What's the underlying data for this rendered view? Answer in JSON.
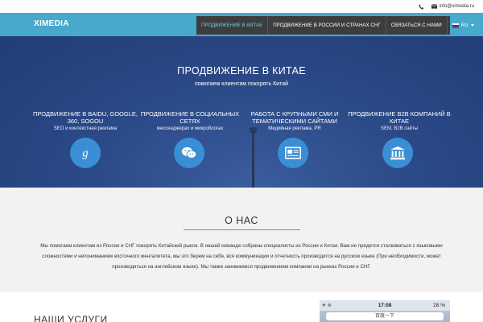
{
  "topbar": {
    "phone_icon": "phone-icon",
    "mail_icon": "envelope-icon",
    "email": "info@ximedia.ru"
  },
  "navbar": {
    "logo": "XIMEDIA",
    "items": [
      {
        "label": "ПРОДВИЖЕНИЕ В КИТАЕ",
        "active": true
      },
      {
        "label": "ПРОДВИЖЕНИЕ В РОССИИ И СТРАНАХ СНГ",
        "active": false
      },
      {
        "label": "СВЯЗАТЬСЯ С НАМИ",
        "active": false
      }
    ],
    "language": "RU",
    "colors": {
      "bar": "#47a9cc",
      "menu": "#3d3d3d",
      "active": "#79c8e6"
    }
  },
  "hero": {
    "title": "ПРОДВИЖЕНИЕ В КИТАЕ",
    "subtitle": "помогаем клиентам покорять Китай",
    "features": [
      {
        "title": "ПРОДВИЖЕНИЕ В BAIDU, GOOGLE, 360, SOGOU",
        "desc": "SEO и контекстная реклама",
        "icon": "google-plus-icon"
      },
      {
        "title": "ПРОДВИЖЕНИЕ В СОЦИАЛЬНЫХ СЕТЯХ",
        "desc": "мессенджерах и микроблогах",
        "icon": "wechat-icon"
      },
      {
        "title": "РАБОТА С КРУПНЫМИ СМИ И ТЕМАТИЧЕСКИМИ САЙТАМИ",
        "desc": "Медийная реклама, PR",
        "icon": "newspaper-icon"
      },
      {
        "title": "ПРОДВИЖЕНИЕ B2B КОМПАНИЙ В КИТАЕ",
        "desc": "SEM, B2B сайты",
        "icon": "institution-icon"
      }
    ],
    "icon_color": "#3a8fd4"
  },
  "about": {
    "title": "О НАС",
    "text": "Мы помогаем клиентам из России и СНГ покорять Китайский рынок. В нашей команде собраны специалисты из России и Китая. Вам не придется сталкиваться с языковыми сложностями и непониманием восточного менталитета, мы это берем на себя, вся коммуникации и отчетность производится на русском языке (При необходимости, может производиться на английском языке). Мы также занимаемся продвижением компании на рынках России и СНГ."
  },
  "services": {
    "title": "НАШИ УСЛУГИ",
    "phone_screenshot": {
      "time": "17:08",
      "battery": "28 %",
      "search_text": "百度一下"
    }
  }
}
